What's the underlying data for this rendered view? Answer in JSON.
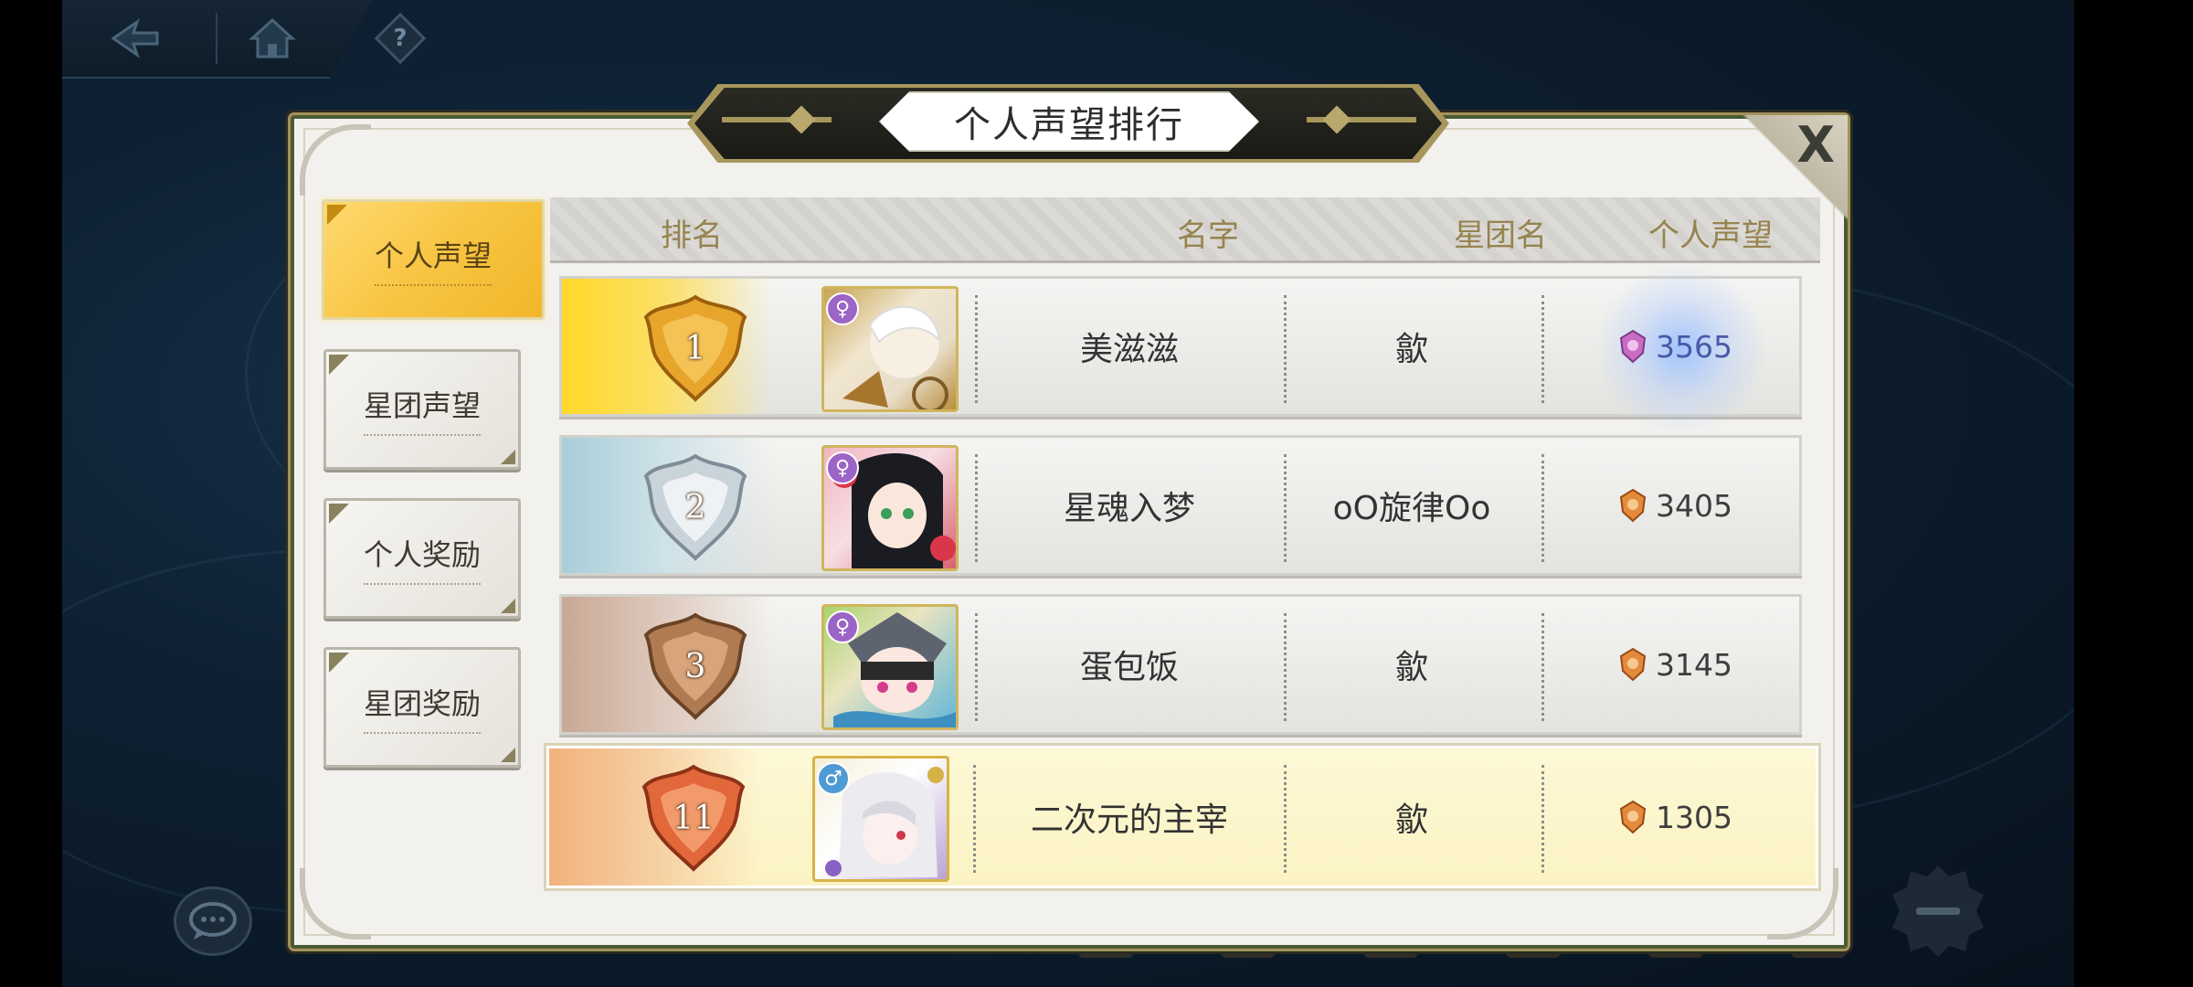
{
  "dialog": {
    "title": "个人声望排行",
    "close_label": "X"
  },
  "top_bar": {
    "help_label": "?"
  },
  "tabs": [
    {
      "label": "个人声望",
      "active": true
    },
    {
      "label": "星团声望",
      "active": false
    },
    {
      "label": "个人奖励",
      "active": false
    },
    {
      "label": "星团奖励",
      "active": false
    }
  ],
  "table": {
    "headers": {
      "rank": "排名",
      "name": "名字",
      "guild": "星团名",
      "score": "个人声望"
    },
    "rows": [
      {
        "rank": "1",
        "name": "美滋滋",
        "guild": "歙",
        "score": "3565",
        "gender": "female",
        "tier": "gold"
      },
      {
        "rank": "2",
        "name": "星魂入梦",
        "guild": "oO旋律Oo",
        "score": "3405",
        "gender": "female",
        "tier": "silver"
      },
      {
        "rank": "3",
        "name": "蛋包饭",
        "guild": "歙",
        "score": "3145",
        "gender": "female",
        "tier": "bronze"
      }
    ],
    "my_row": {
      "rank": "11",
      "name": "二次元的主宰",
      "guild": "歙",
      "score": "1305",
      "gender": "male",
      "tier": "orange"
    }
  },
  "icons": {
    "back": "back-arrow-icon",
    "home": "home-icon",
    "help": "help-icon",
    "chat": "chat-icon",
    "menu": "minus-icon",
    "reputation": "reputation-medal-icon"
  },
  "colors": {
    "gold": "#ffd928",
    "silver": "#a9ced9",
    "bronze": "#c9a894",
    "orange": "#f2b27e",
    "my_row_bg": "#fbf3c3",
    "header_text": "#96834f"
  }
}
